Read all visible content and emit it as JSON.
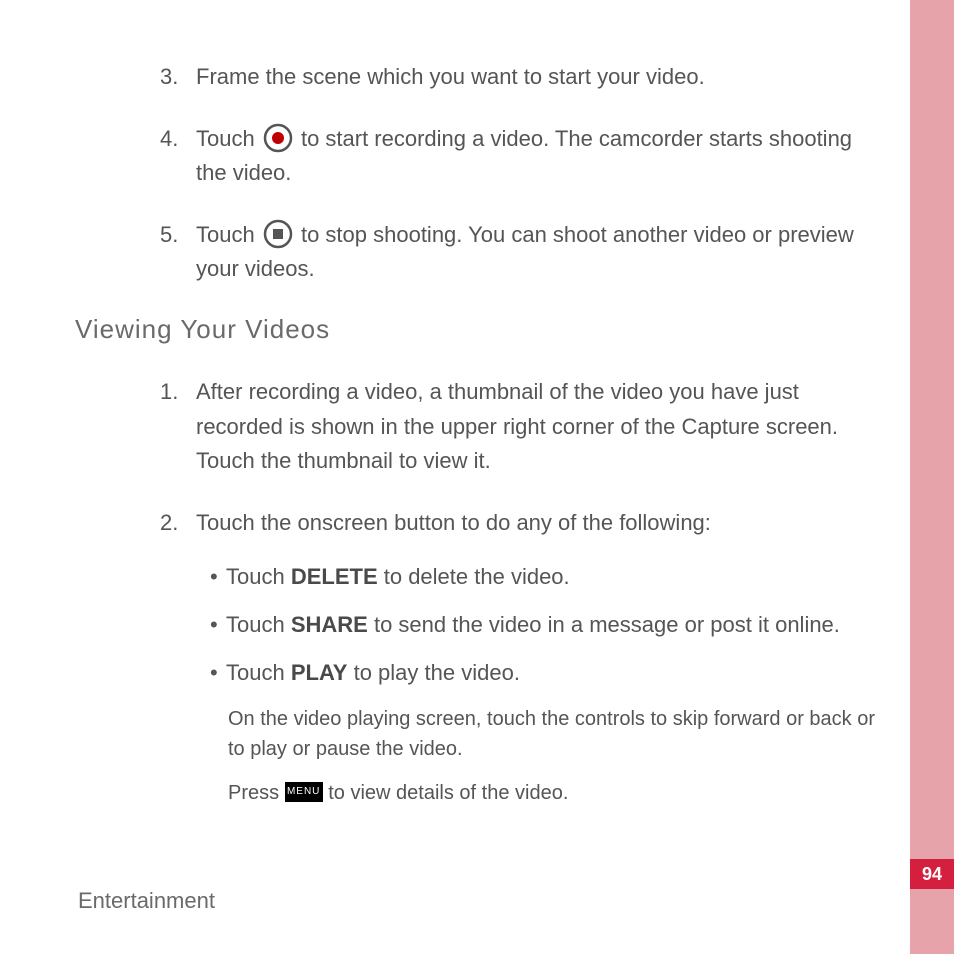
{
  "steps_top": {
    "step3": {
      "num": "3.",
      "text": "Frame the scene which you want to start your video."
    },
    "step4": {
      "num": "4.",
      "before": "Touch ",
      "after": " to start recording a video. The camcorder starts shooting the video."
    },
    "step5": {
      "num": "5.",
      "before": "Touch ",
      "after": " to stop shooting. You can shoot another video or preview your videos."
    }
  },
  "heading": "Viewing  Your  Videos",
  "viewing": {
    "step1": {
      "num": "1.",
      "text": "After recording a video, a thumbnail of the video you have just recorded is shown in the upper right corner of the Capture screen. Touch the thumbnail to view it."
    },
    "step2": {
      "num": "2.",
      "text": "Touch the onscreen button to do any of the following:",
      "bullets": {
        "b1": {
          "before": "Touch ",
          "bold": "DELETE",
          "after": " to delete the video."
        },
        "b2": {
          "before": "Touch ",
          "bold": "SHARE",
          "after": " to send the video in a message or post it online."
        },
        "b3": {
          "before": "Touch ",
          "bold": "PLAY",
          "after": " to play the video."
        }
      }
    }
  },
  "note1": "On the video playing screen, touch the controls to skip forward or back or to play or pause the video.",
  "note2": {
    "before": "Press ",
    "after": " to view details of the video."
  },
  "menu_label": "MENU",
  "footer": "Entertainment",
  "page_number": "94"
}
